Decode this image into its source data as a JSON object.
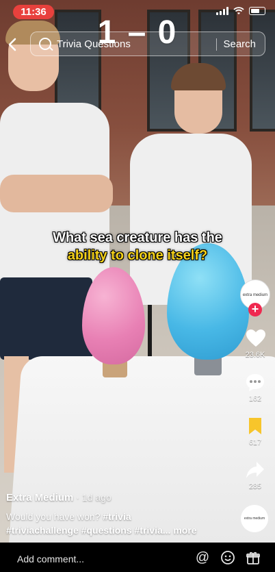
{
  "status": {
    "time": "11:36"
  },
  "score": "1 – 0",
  "search": {
    "query": "Trivia Questions",
    "button": "Search"
  },
  "caption": {
    "line1": "What sea creature has the",
    "line2": "ability to clone itself?"
  },
  "actions": {
    "avatar_label": "extra medium",
    "likes": "23.6K",
    "comments": "162",
    "saves": "617",
    "shares": "285",
    "music_label": "extra medium"
  },
  "post": {
    "author": "Extra Medium",
    "time": "· 1d ago",
    "desc_text": "Would you have won? ",
    "tag1": "#trivia",
    "tag2": "#triviachallenge",
    "tag3": "#questions",
    "tag4": "#trivia...",
    "more": "more"
  },
  "comment_bar": {
    "placeholder": "Add comment..."
  },
  "colors": {
    "accent": "#ef2950",
    "caption_highlight": "#f5d21b",
    "bookmark": "#f7c52b",
    "time_pill": "#e8413d"
  }
}
